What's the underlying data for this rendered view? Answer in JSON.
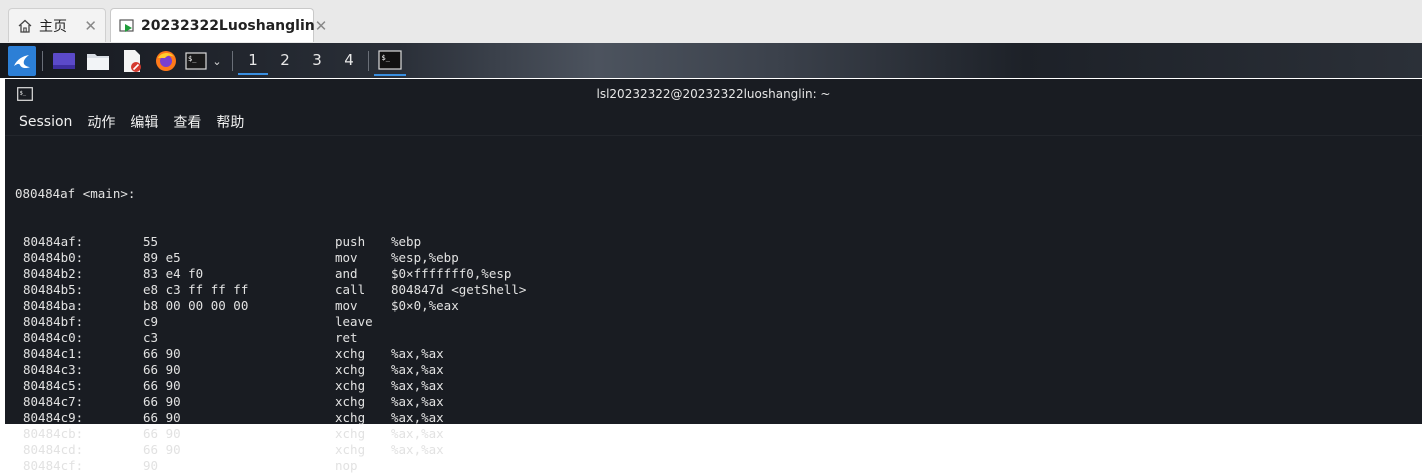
{
  "tabs": [
    {
      "label": "主页",
      "icon": "home-icon"
    },
    {
      "label": "20232322Luoshanglin",
      "icon": "vm-running-icon"
    }
  ],
  "panel": {
    "workspaces": [
      "1",
      "2",
      "3",
      "4"
    ],
    "active_workspace": "1"
  },
  "terminal": {
    "title": "lsl20232322@20232322luoshanglin: ~",
    "menu": [
      "Session",
      "动作",
      "编辑",
      "查看",
      "帮助"
    ],
    "header": "080484af <main>:",
    "lines": [
      {
        "addr": "80484af:",
        "bytes": "55",
        "op": "push",
        "arg": "%ebp"
      },
      {
        "addr": "80484b0:",
        "bytes": "89 e5",
        "op": "mov",
        "arg": "%esp,%ebp"
      },
      {
        "addr": "80484b2:",
        "bytes": "83 e4 f0",
        "op": "and",
        "arg": "$0×fffffff0,%esp"
      },
      {
        "addr": "80484b5:",
        "bytes": "e8 c3 ff ff ff",
        "op": "call",
        "arg": "804847d <getShell>"
      },
      {
        "addr": "80484ba:",
        "bytes": "b8 00 00 00 00",
        "op": "mov",
        "arg": "$0×0,%eax"
      },
      {
        "addr": "80484bf:",
        "bytes": "c9",
        "op": "leave",
        "arg": ""
      },
      {
        "addr": "80484c0:",
        "bytes": "c3",
        "op": "ret",
        "arg": ""
      },
      {
        "addr": "80484c1:",
        "bytes": "66 90",
        "op": "xchg",
        "arg": "%ax,%ax"
      },
      {
        "addr": "80484c3:",
        "bytes": "66 90",
        "op": "xchg",
        "arg": "%ax,%ax"
      },
      {
        "addr": "80484c5:",
        "bytes": "66 90",
        "op": "xchg",
        "arg": "%ax,%ax"
      },
      {
        "addr": "80484c7:",
        "bytes": "66 90",
        "op": "xchg",
        "arg": "%ax,%ax"
      },
      {
        "addr": "80484c9:",
        "bytes": "66 90",
        "op": "xchg",
        "arg": "%ax,%ax"
      },
      {
        "addr": "80484cb:",
        "bytes": "66 90",
        "op": "xchg",
        "arg": "%ax,%ax"
      },
      {
        "addr": "80484cd:",
        "bytes": "66 90",
        "op": "xchg",
        "arg": "%ax,%ax"
      },
      {
        "addr": "80484cf:",
        "bytes": "90",
        "op": "nop",
        "arg": ""
      }
    ]
  }
}
